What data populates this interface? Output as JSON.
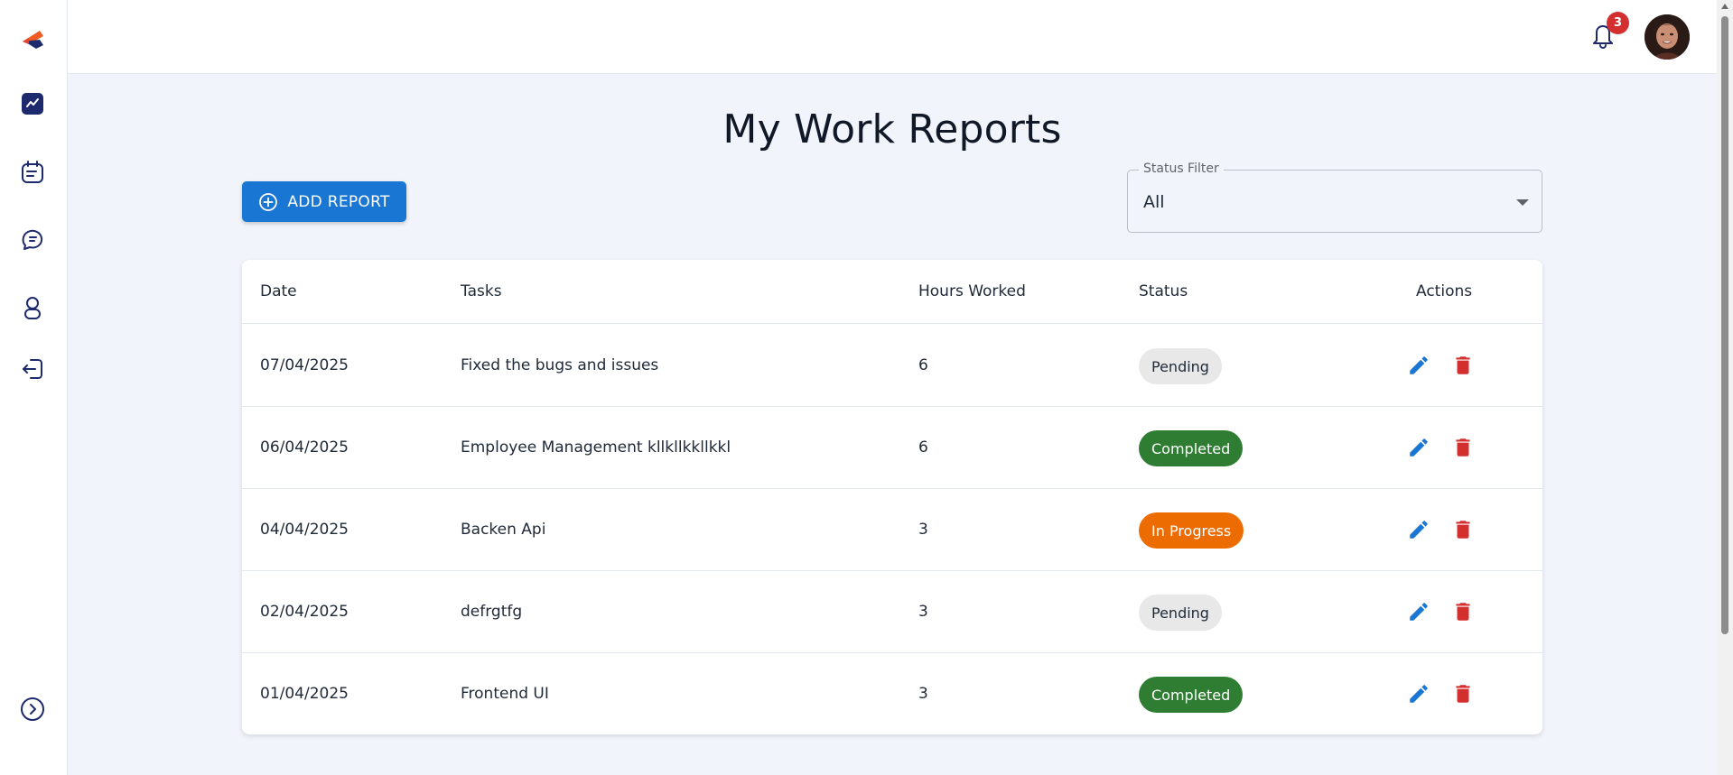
{
  "notifications": {
    "count": "3"
  },
  "page": {
    "title": "My Work Reports"
  },
  "toolbar": {
    "add_label": "ADD REPORT"
  },
  "filter": {
    "label": "Status Filter",
    "value": "All"
  },
  "table": {
    "headers": {
      "date": "Date",
      "tasks": "Tasks",
      "hours": "Hours Worked",
      "status": "Status",
      "actions": "Actions"
    },
    "rows": [
      {
        "date": "07/04/2025",
        "task": "Fixed the bugs and issues",
        "hours": "6",
        "status": "Pending",
        "status_type": "pending"
      },
      {
        "date": "06/04/2025",
        "task": "Employee Management kllkllkkllkkl",
        "hours": "6",
        "status": "Completed",
        "status_type": "completed"
      },
      {
        "date": "04/04/2025",
        "task": "Backen Api",
        "hours": "3",
        "status": "In Progress",
        "status_type": "progress"
      },
      {
        "date": "02/04/2025",
        "task": "defrgtfg",
        "hours": "3",
        "status": "Pending",
        "status_type": "pending"
      },
      {
        "date": "01/04/2025",
        "task": "Frontend UI",
        "hours": "3",
        "status": "Completed",
        "status_type": "completed"
      }
    ]
  },
  "colors": {
    "primary": "#1976d2",
    "danger": "#d32f2f",
    "success": "#2e7d32",
    "warning": "#ed6c02",
    "nav": "#1e2a6e"
  },
  "icons": [
    "logo",
    "dashboard-icon",
    "calendar-list-icon",
    "chat-icon",
    "user-icon",
    "logout-icon",
    "expand-icon",
    "bell-icon",
    "add-circle-icon",
    "edit-icon",
    "delete-icon"
  ]
}
